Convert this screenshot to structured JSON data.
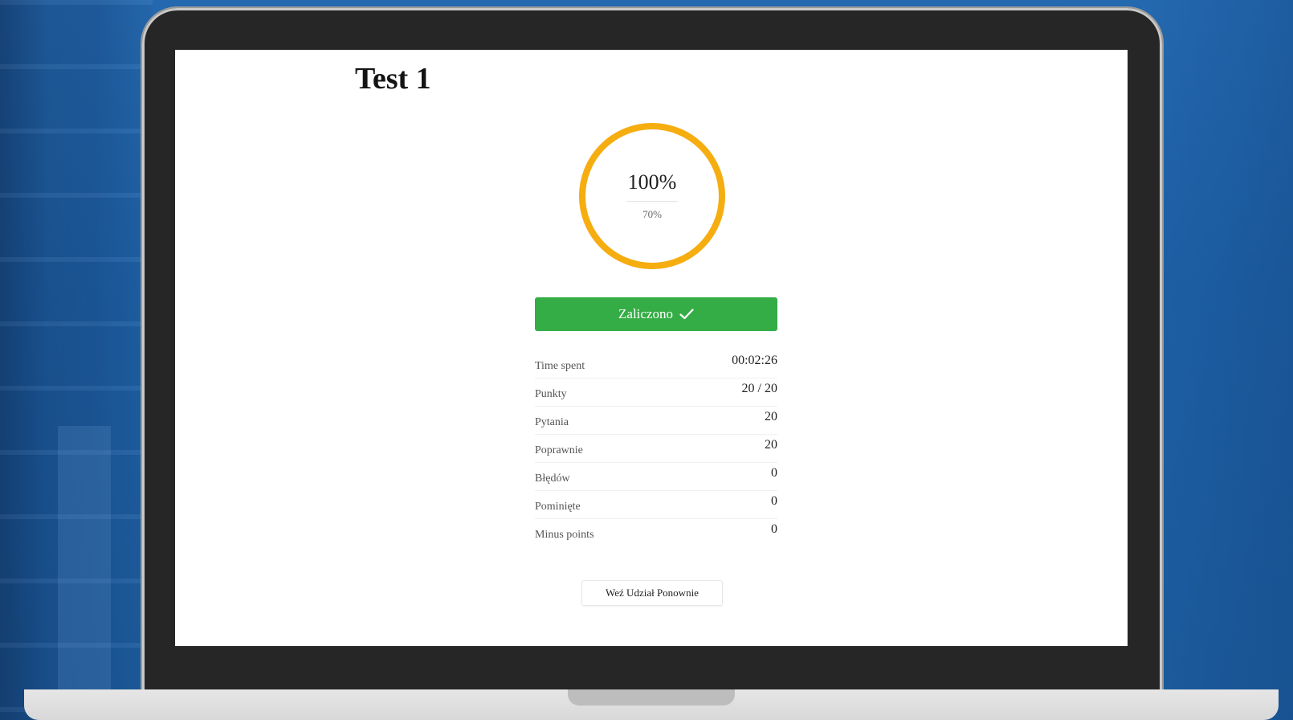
{
  "page": {
    "title": "Test 1"
  },
  "score": {
    "percent_label": "100%",
    "pass_threshold_label": "70%",
    "percent_value": 100,
    "ring_color": "#f5ad10"
  },
  "status": {
    "label": "Zaliczono",
    "icon": "checkmark-icon",
    "color": "#35ad46"
  },
  "stats": [
    {
      "label": "Time spent",
      "value": "00:02:26"
    },
    {
      "label": "Punkty",
      "value": "20 / 20"
    },
    {
      "label": "Pytania",
      "value": "20"
    },
    {
      "label": "Poprawnie",
      "value": "20"
    },
    {
      "label": "Błędów",
      "value": "0"
    },
    {
      "label": "Pominięte",
      "value": "0"
    },
    {
      "label": "Minus points",
      "value": "0"
    }
  ],
  "actions": {
    "retake_label": "Weź Udział Ponownie"
  }
}
